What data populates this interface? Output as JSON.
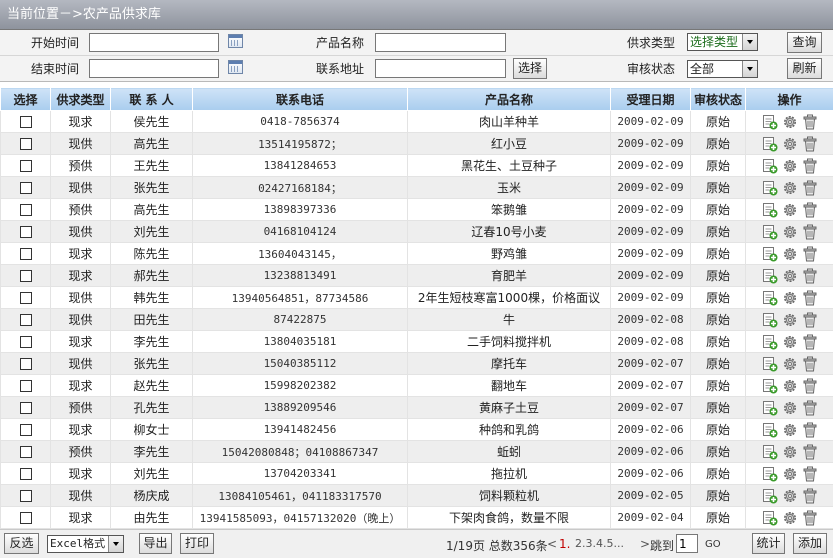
{
  "titlebar": {
    "text": "当前位置－>农产品供求库"
  },
  "filters": {
    "start_label": "开始时间",
    "start_value": "",
    "end_label": "结束时间",
    "end_value": "",
    "product_label": "产品名称",
    "product_value": "",
    "address_label": "联系地址",
    "address_value": "",
    "select_button": "选择",
    "type_label": "供求类型",
    "type_value": "选择类型",
    "status_label": "审核状态",
    "status_value": "全部",
    "query_button": "查询",
    "refresh_button": "刷新"
  },
  "table": {
    "headers": [
      "选择",
      "供求类型",
      "联 系 人",
      "联系电话",
      "产品名称",
      "受理日期",
      "审核状态",
      "操作"
    ],
    "rows": [
      {
        "type": "现求",
        "contact": "侯先生",
        "phone": "0418-7856374",
        "product": "肉山羊种羊",
        "date": "2009-02-09",
        "status": "原始"
      },
      {
        "type": "现供",
        "contact": "高先生",
        "phone": "13514195872；",
        "product": "红小豆",
        "date": "2009-02-09",
        "status": "原始"
      },
      {
        "type": "预供",
        "contact": "王先生",
        "phone": "13841284653",
        "product": "黑花生、土豆种子",
        "date": "2009-02-09",
        "status": "原始"
      },
      {
        "type": "现供",
        "contact": "张先生",
        "phone": "02427168184；",
        "product": "玉米",
        "date": "2009-02-09",
        "status": "原始"
      },
      {
        "type": "预供",
        "contact": "高先生",
        "phone": "13898397336",
        "product": "笨鹅雏",
        "date": "2009-02-09",
        "status": "原始"
      },
      {
        "type": "现供",
        "contact": "刘先生",
        "phone": "04168104124",
        "product": "辽春10号小麦",
        "date": "2009-02-09",
        "status": "原始"
      },
      {
        "type": "现求",
        "contact": "陈先生",
        "phone": "13604043145，",
        "product": "野鸡雏",
        "date": "2009-02-09",
        "status": "原始"
      },
      {
        "type": "现求",
        "contact": "郝先生",
        "phone": "13238813491",
        "product": "育肥羊",
        "date": "2009-02-09",
        "status": "原始"
      },
      {
        "type": "现供",
        "contact": "韩先生",
        "phone": "13940564851，87734586",
        "product": "2年生短枝寒富1000棵，价格面议",
        "date": "2009-02-09",
        "status": "原始"
      },
      {
        "type": "现供",
        "contact": "田先生",
        "phone": "87422875",
        "product": "牛",
        "date": "2009-02-08",
        "status": "原始"
      },
      {
        "type": "现求",
        "contact": "李先生",
        "phone": "13804035181",
        "product": "二手饲料搅拌机",
        "date": "2009-02-08",
        "status": "原始"
      },
      {
        "type": "现供",
        "contact": "张先生",
        "phone": "15040385112",
        "product": "摩托车",
        "date": "2009-02-07",
        "status": "原始"
      },
      {
        "type": "现求",
        "contact": "赵先生",
        "phone": "15998202382",
        "product": "翻地车",
        "date": "2009-02-07",
        "status": "原始"
      },
      {
        "type": "预供",
        "contact": "孔先生",
        "phone": "13889209546",
        "product": "黄麻子土豆",
        "date": "2009-02-07",
        "status": "原始"
      },
      {
        "type": "现求",
        "contact": "柳女士",
        "phone": "13941482456",
        "product": "种鸽和乳鸽",
        "date": "2009-02-06",
        "status": "原始"
      },
      {
        "type": "预供",
        "contact": "李先生",
        "phone": "15042080848；04108867347",
        "product": "蚯蚓",
        "date": "2009-02-06",
        "status": "原始"
      },
      {
        "type": "现求",
        "contact": "刘先生",
        "phone": "13704203341",
        "product": "拖拉机",
        "date": "2009-02-06",
        "status": "原始"
      },
      {
        "type": "现供",
        "contact": "杨庆成",
        "phone": "13084105461，041183317570",
        "product": "饲料颗粒机",
        "date": "2009-02-05",
        "status": "原始"
      },
      {
        "type": "现求",
        "contact": "由先生",
        "phone": "13941585093，04157132020（晚上）",
        "product": "下架肉食鸽，数量不限",
        "date": "2009-02-04",
        "status": "原始"
      }
    ]
  },
  "footer": {
    "invert_button": "反选",
    "format_value": "Excel格式",
    "export_button": "导出",
    "print_button": "打印",
    "page_info": "1/19页 总数356条",
    "pager_prev": "<",
    "pager_current": "1.",
    "pager_pages": "2.3.4.5...",
    "pager_next": ">",
    "jump_label": "跳到",
    "jump_value": "1",
    "go_label": "GO",
    "stats_button": "统计",
    "add_button": "添加"
  },
  "colors": {
    "header_bg": "#bcd8f2",
    "row_alt": "#eeeeee",
    "titlebar": "#9ca0a9"
  },
  "icons": {
    "action_1": "add-note-icon",
    "action_2": "gear-icon",
    "action_3": "trash-icon"
  }
}
